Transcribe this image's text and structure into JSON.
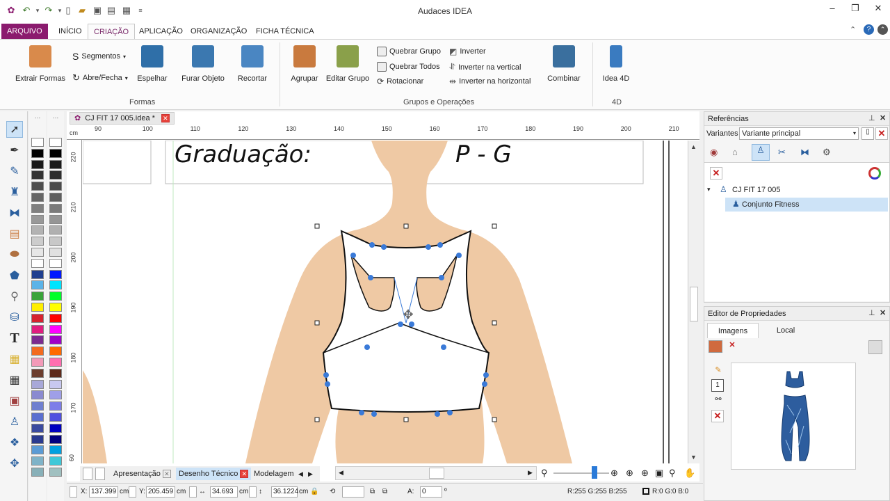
{
  "window": {
    "title": "Audaces IDEA"
  },
  "quick_access": [
    "app-icon",
    "undo-icon",
    "redo-icon",
    "new-file-icon",
    "open-folder-icon",
    "save-icon",
    "save-as-icon",
    "print-preview-icon",
    "customize-icon"
  ],
  "window_controls": {
    "minimize": "–",
    "restore": "❐",
    "close": "✕"
  },
  "tabs": [
    "ARQUIVO",
    "INÍCIO",
    "CRIAÇÃO",
    "APLICAÇÃO",
    "ORGANIZAÇÃO",
    "FICHA TÉCNICA"
  ],
  "ribbon": {
    "formas": {
      "label": "Formas",
      "extrair": "Extrair Formas",
      "segmentos": "Segmentos",
      "abre_fecha": "Abre/Fecha",
      "espelhar": "Espelhar",
      "furar": "Furar Objeto",
      "recortar": "Recortar"
    },
    "grupos": {
      "label": "Grupos e Operações",
      "agrupar": "Agrupar",
      "editar_grupo": "Editar Grupo",
      "quebrar_grupo": "Quebrar Grupo",
      "quebrar_todos": "Quebrar Todos",
      "rotacionar": "Rotacionar",
      "inverter": "Inverter",
      "inverter_vertical": "Inverter na vertical",
      "inverter_horizontal": "Inverter na horizontal",
      "combinar": "Combinar"
    },
    "idea4d": {
      "label": "4D",
      "button": "Idea 4D"
    }
  },
  "document": {
    "tab_label": "CJ FIT 17 005.idea *",
    "ruler_unit": "cm",
    "ruler_top": [
      "90",
      "100",
      "110",
      "120",
      "130",
      "140",
      "150",
      "160",
      "170",
      "180",
      "190",
      "200",
      "210"
    ],
    "ruler_left": [
      "220",
      "210",
      "200",
      "190",
      "180",
      "170",
      "60"
    ],
    "graduacao_label": "Graduação:",
    "graduacao_value": "P - G"
  },
  "sheet_tabs": {
    "apresentacao": "Apresentação",
    "desenho_tecnico": "Desenho Técnico",
    "modelagem": "Modelagem"
  },
  "status": {
    "x_label": "X:",
    "x_value": "137.399",
    "x_unit": "cm",
    "y_label": "Y:",
    "y_value": "205.459",
    "y_unit": "cm",
    "w_value": "34.693",
    "w_unit": "cm",
    "h_value": "36.1224",
    "h_unit": "cm",
    "angle_label": "A:",
    "angle_value": "0",
    "angle_unit": "º",
    "rgb": "R:255  G:255  B:255",
    "rgb2": "R:0  G:0  B:0"
  },
  "referencias": {
    "title": "Referências",
    "variantes_label": "Variantes",
    "variante_selected": "Variante principal",
    "tree_root": "CJ FIT 17 005",
    "tree_child": "Conjunto Fitness"
  },
  "propriedades": {
    "title": "Editor de Propriedades",
    "tab_imagens": "Imagens",
    "tab_local": "Local"
  },
  "palette_col1": [
    "#ffffff",
    "#000000",
    "#1a1a1a",
    "#333333",
    "#4d4d4d",
    "#666666",
    "#808080",
    "#999999",
    "#b3b3b3",
    "#cccccc",
    "#e6e6e6",
    "#ffffff",
    "#1f3f8f",
    "#5bb3e8",
    "#3aa33a",
    "#ffee00",
    "#d6232e",
    "#e01e7f",
    "#7b2b8f",
    "#f26b1f",
    "#f39ab8",
    "#6b3d2e",
    "#a8a8d8",
    "#8a8ad0",
    "#6f7fcf",
    "#5a6fd0",
    "#3a4a9f",
    "#2a3a8f",
    "#5b9bd5",
    "#7fb3c8",
    "#88b0b8"
  ],
  "palette_col2": [
    "#ffffff",
    "#000000",
    "#1a1a1a",
    "#2d2d2d",
    "#4a4a4a",
    "#5e5e5e",
    "#7a7a7a",
    "#959595",
    "#b0b0b0",
    "#c8c8c8",
    "#e0e0e0",
    "#ffffff",
    "#0018ff",
    "#00e5ff",
    "#00ff2a",
    "#ffff00",
    "#ff0000",
    "#ff00ff",
    "#a000c8",
    "#ff6a00",
    "#ff6fb0",
    "#5e2a1a",
    "#c8c8f0",
    "#9f9fe8",
    "#7d7de8",
    "#4f4fe0",
    "#0000c0",
    "#000080",
    "#00a0e0",
    "#3fc8d8",
    "#a0c0c0"
  ],
  "colors": {
    "accent": "#8b1b6e",
    "skin": "#efc9a4",
    "handle": "#3a7ad8",
    "selection": "#cde3f7"
  }
}
